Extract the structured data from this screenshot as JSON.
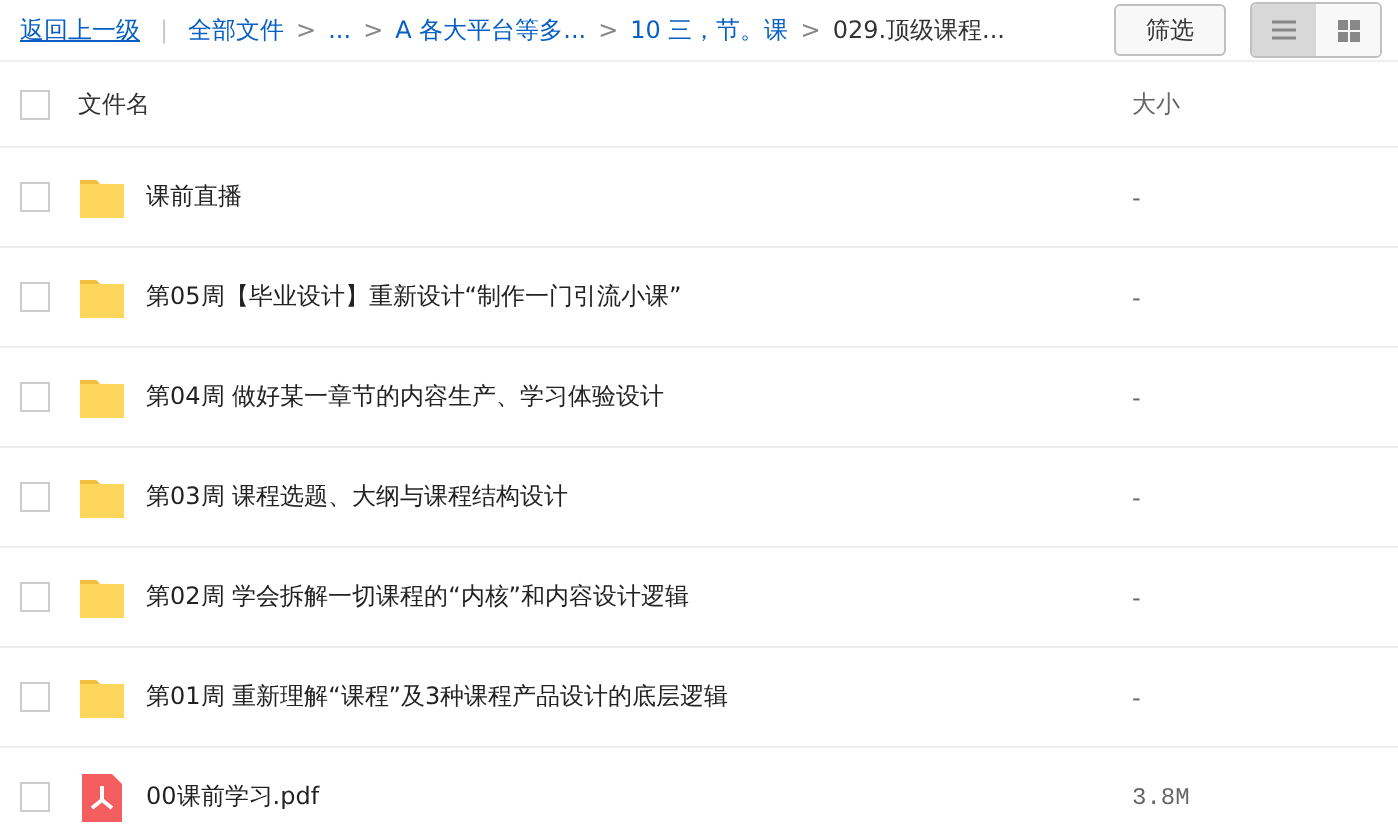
{
  "toolbar": {
    "back_link": "返回上一级",
    "separator": "|",
    "breadcrumbs": [
      {
        "label": "全部文件",
        "current": false
      },
      {
        "label": "...",
        "current": false
      },
      {
        "label": "A 各大平台等多...",
        "current": false
      },
      {
        "label": "10 三，节。课",
        "current": false
      },
      {
        "label": "029.顶级课程...",
        "current": true
      }
    ],
    "breadcrumb_arrow": ">",
    "filter_button": "筛选",
    "views": [
      {
        "kind": "list",
        "selected": true
      },
      {
        "kind": "grid",
        "selected": false
      }
    ]
  },
  "table": {
    "columns": [
      "文件名",
      "大小"
    ],
    "header_checked": false,
    "rows": [
      {
        "kind": "folder",
        "name": "课前直播",
        "size": "-",
        "checked": false
      },
      {
        "kind": "folder",
        "name": "第05周【毕业设计】重新设计“制作一门引流小课”",
        "size": "-",
        "checked": false
      },
      {
        "kind": "folder",
        "name": "第04周 做好某一章节的内容生产、学习体验设计",
        "size": "-",
        "checked": false
      },
      {
        "kind": "folder",
        "name": "第03周 课程选题、大纲与课程结构设计",
        "size": "-",
        "checked": false
      },
      {
        "kind": "folder",
        "name": "第02周 学会拆解一切课程的“内核”和内容设计逻辑",
        "size": "-",
        "checked": false
      },
      {
        "kind": "folder",
        "name": "第01周 重新理解“课程”及3种课程产品设计的底层逻辑",
        "size": "-",
        "checked": false
      },
      {
        "kind": "pdf",
        "name": "00课前学习.pdf",
        "size": "3.8M",
        "checked": false
      }
    ]
  }
}
